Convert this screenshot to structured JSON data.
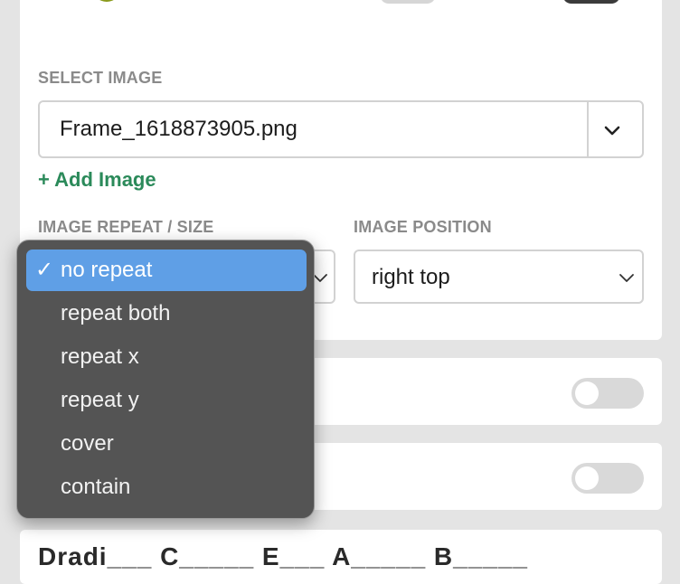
{
  "select_image": {
    "label": "SELECT IMAGE",
    "value": "Frame_1618873905.png",
    "add_label": "+ Add Image"
  },
  "image_repeat": {
    "label": "IMAGE REPEAT / SIZE",
    "options": [
      "no repeat",
      "repeat both",
      "repeat x",
      "repeat y",
      "cover",
      "contain"
    ],
    "selected": "no repeat",
    "check": "✓"
  },
  "image_position": {
    "label": "IMAGE POSITION",
    "value": "right top"
  },
  "rows": [
    {
      "toggle_on": false
    },
    {
      "toggle_on": false
    }
  ],
  "bottom_row": {
    "title": "Dradi___ C_____ E___ A_____ B_____"
  },
  "colors": {
    "accent_green": "#2b8a5a",
    "menu_selected": "#5f9fe6",
    "menu_bg": "#545454",
    "toggle_off": "#d9d9d9"
  },
  "icons": [
    "chevron-down-icon",
    "checkmark-icon",
    "toggle-switch"
  ]
}
